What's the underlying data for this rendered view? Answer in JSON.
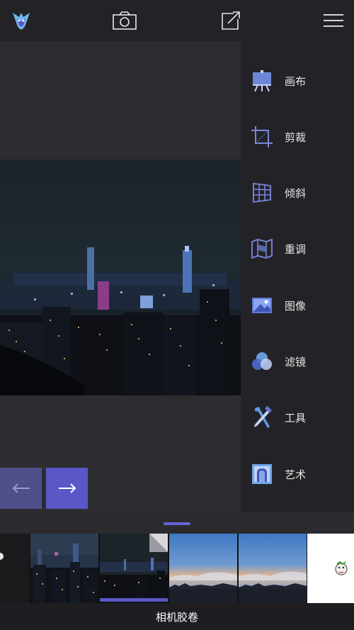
{
  "topbar": {
    "logo_icon": "app-logo-icon",
    "camera_icon": "camera-icon",
    "share_icon": "share-icon",
    "menu_icon": "hamburger-menu-icon"
  },
  "tools": [
    {
      "label": "画布",
      "icon": "canvas-easel-icon"
    },
    {
      "label": "剪裁",
      "icon": "crop-icon"
    },
    {
      "label": "倾斜",
      "icon": "perspective-icon"
    },
    {
      "label": "重调",
      "icon": "reshape-icon"
    },
    {
      "label": "图像",
      "icon": "image-icon"
    },
    {
      "label": "滤镜",
      "icon": "filter-icon"
    },
    {
      "label": "工具",
      "icon": "tools-icon"
    },
    {
      "label": "艺术",
      "icon": "art-icon"
    }
  ],
  "nav": {
    "prev_label": "←",
    "next_label": "→"
  },
  "bottom": {
    "title": "相机胶卷"
  },
  "colors": {
    "accent": "#5b57c6",
    "panel": "#232327",
    "background": "#2b2b2f"
  }
}
